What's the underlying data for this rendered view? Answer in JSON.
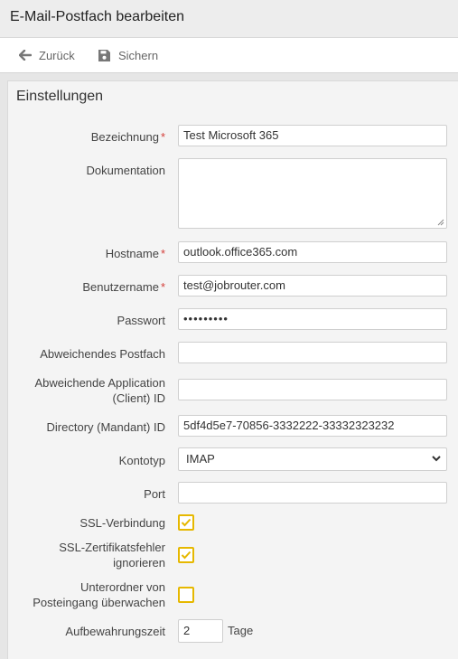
{
  "header": {
    "title": "E-Mail-Postfach bearbeiten"
  },
  "toolbar": {
    "back_label": "Zurück",
    "save_label": "Sichern"
  },
  "panel": {
    "title": "Einstellungen"
  },
  "form": {
    "bezeichnung": {
      "label": "Bezeichnung",
      "value": "Test Microsoft 365",
      "required": "*"
    },
    "dokumentation": {
      "label": "Dokumentation",
      "value": ""
    },
    "hostname": {
      "label": "Hostname",
      "value": "outlook.office365.com",
      "required": "*"
    },
    "benutzername": {
      "label": "Benutzername",
      "value": "test@jobrouter.com",
      "required": "*"
    },
    "passwort": {
      "label": "Passwort",
      "value": "•••••••••"
    },
    "abweichendes_postfach": {
      "label": "Abweichendes Postfach",
      "value": ""
    },
    "application_id": {
      "label_line1": "Abweichende Application",
      "label_line2": "(Client) ID",
      "value": ""
    },
    "directory_id": {
      "label": "Directory (Mandant) ID",
      "value": "5df4d5e7-70856-3332222-33332323232"
    },
    "kontotyp": {
      "label": "Kontotyp",
      "value": "IMAP"
    },
    "port": {
      "label": "Port",
      "value": ""
    },
    "ssl": {
      "label": "SSL-Verbindung",
      "checked": true
    },
    "ssl_errors": {
      "label_line1": "SSL-Zertifikatsfehler",
      "label_line2": "ignorieren",
      "checked": true
    },
    "subfolders": {
      "label_line1": "Unterordner von",
      "label_line2": "Posteingang überwachen",
      "checked": false
    },
    "retention": {
      "label": "Aufbewahrungszeit",
      "value": "2",
      "unit": "Tage"
    }
  },
  "colors": {
    "required": "#d43f3a",
    "checkbox_accent": "#e6b800"
  }
}
